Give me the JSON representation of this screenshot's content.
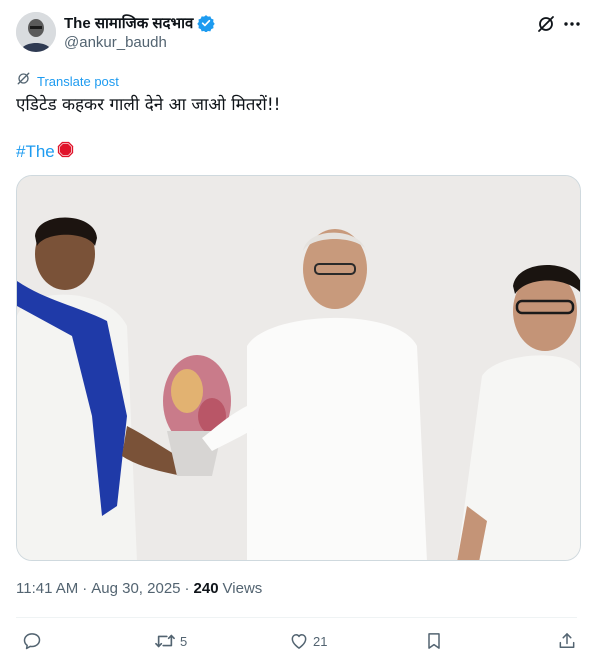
{
  "user": {
    "display_name": "The सामाजिक सदभाव",
    "handle": "@ankur_baudh",
    "verified": true
  },
  "translate_label": "Translate post",
  "post": {
    "text": "एडिटेड कहकर गाली देने आ जाओ मितरों!!",
    "hashtag": "#The",
    "emoji": "stop-sign"
  },
  "meta": {
    "time": "11:41 AM",
    "separator1": "·",
    "date": "Aug 30, 2025",
    "separator2": "·",
    "views_count": "240",
    "views_label": "Views"
  },
  "actions": {
    "reply_count": "",
    "repost_count": "5",
    "like_count": "21"
  },
  "colors": {
    "accent": "#1d9bf0",
    "text_primary": "#0f1419",
    "text_secondary": "#536471",
    "stop_red": "#e0142a"
  }
}
